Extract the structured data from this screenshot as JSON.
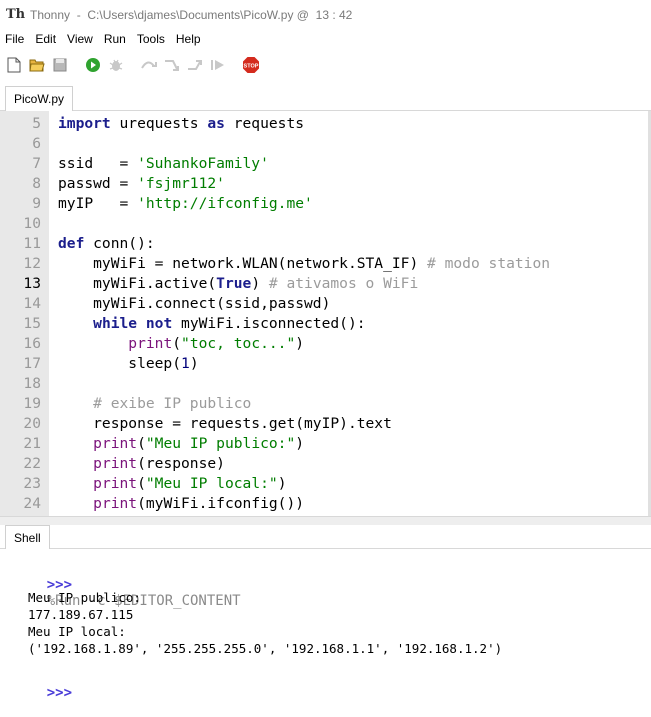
{
  "window": {
    "app_name": "Thonny",
    "path": "C:\\Users\\djames\\Documents\\PicoW.py",
    "separator": "@",
    "cursor": "13 : 42"
  },
  "menu": [
    "File",
    "Edit",
    "View",
    "Run",
    "Tools",
    "Help"
  ],
  "toolbar": {
    "buttons": [
      "new-file",
      "open-file",
      "save-file",
      "run",
      "debug",
      "step-over",
      "step-into",
      "step-out",
      "resume",
      "stop"
    ],
    "stop_label": "STOP"
  },
  "editor": {
    "tab_label": "PicoW.py",
    "current_line": 13,
    "line_numbers": [
      "5",
      "6",
      "7",
      "8",
      "9",
      "10",
      "11",
      "12",
      "13",
      "14",
      "15",
      "16",
      "17",
      "18",
      "19",
      "20",
      "21",
      "22",
      "23",
      "24"
    ]
  },
  "code_tokens": {
    "l5": {
      "k1": "import",
      "t1": " urequests ",
      "k2": "as",
      "t2": " requests"
    },
    "l7": {
      "t1": "ssid   = ",
      "s1": "'SuhankoFamily'"
    },
    "l8": {
      "t1": "passwd = ",
      "s1": "'fsjmr112'"
    },
    "l9": {
      "t1": "myIP   = ",
      "s1": "'http://ifconfig.me'"
    },
    "l11": {
      "k1": "def",
      "t1": " conn():"
    },
    "l12": {
      "t1": "    myWiFi = network.WLAN(network.STA_IF) ",
      "c1": "# modo station"
    },
    "l13": {
      "t1": "    myWiFi.active(",
      "k1": "True",
      "t2": ") ",
      "c1": "# ativamos o WiFi"
    },
    "l14": {
      "t1": "    myWiFi.connect(ssid,passwd)"
    },
    "l15": {
      "t0": "    ",
      "k1": "while",
      "t1": " ",
      "k2": "not",
      "t2": " myWiFi.isconnected():"
    },
    "l16": {
      "t0": "        ",
      "b1": "print",
      "t1": "(",
      "s1": "\"toc, toc...\"",
      "t2": ")"
    },
    "l17": {
      "t1": "        sleep(",
      "n1": "1",
      "t2": ")"
    },
    "l19": {
      "c1": "    # exibe IP publico"
    },
    "l20": {
      "t1": "    response = requests.get(myIP).text"
    },
    "l21": {
      "t0": "    ",
      "b1": "print",
      "t1": "(",
      "s1": "\"Meu IP publico:\"",
      "t2": ")"
    },
    "l22": {
      "t0": "    ",
      "b1": "print",
      "t1": "(response)"
    },
    "l23": {
      "t0": "    ",
      "b1": "print",
      "t1": "(",
      "s1": "\"Meu IP local:\"",
      "t2": ")"
    },
    "l24": {
      "t0": "    ",
      "b1": "print",
      "t1": "(myWiFi.ifconfig())"
    }
  },
  "shell": {
    "tab_label": "Shell",
    "prompt": ">>>",
    "command": "%Run -c $EDITOR_CONTENT",
    "output": [
      "Meu IP publico:",
      "177.189.67.115",
      "Meu IP local:",
      "('192.168.1.89', '255.255.255.0', '192.168.1.1', '192.168.1.2')"
    ]
  }
}
